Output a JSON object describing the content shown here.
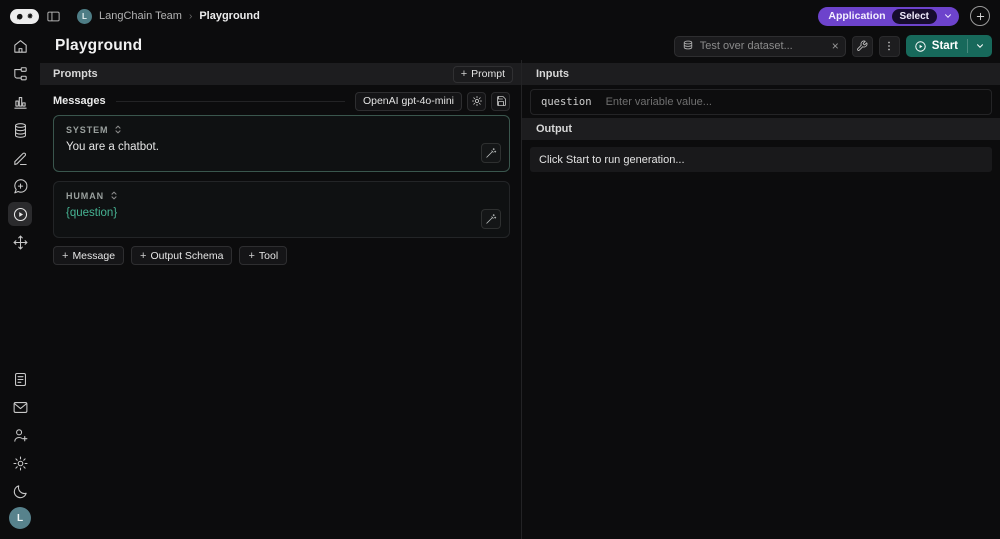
{
  "topbar": {
    "team_name": "LangChain Team",
    "breadcrumb_separator": "›",
    "page_name": "Playground",
    "avatar_letter": "L",
    "application_button": "Application",
    "select_button": "Select"
  },
  "page_header": {
    "title": "Playground",
    "dataset_input_placeholder": "Test over dataset...",
    "start_button": "Start"
  },
  "prompts_panel": {
    "header": "Prompts",
    "add_prompt": "Prompt",
    "messages_header": "Messages",
    "model_selector": "OpenAI gpt-4o-mini",
    "messages": [
      {
        "role": "SYSTEM",
        "content": "You are a chatbot."
      },
      {
        "role": "HUMAN",
        "content": "{question}"
      }
    ],
    "add_message": "Message",
    "add_output_schema": "Output Schema",
    "add_tool": "Tool"
  },
  "io_panel": {
    "inputs_header": "Inputs",
    "variable_name": "question",
    "variable_placeholder": "Enter variable value...",
    "output_header": "Output",
    "output_empty_text": "Click Start to run generation..."
  },
  "sidebar": {
    "avatar_letter": "L",
    "nav_icons": [
      "home",
      "tracing",
      "dashboards",
      "datasets",
      "annotation",
      "feedback",
      "playground",
      "deployments"
    ],
    "bottom_icons": [
      "docs",
      "mail",
      "invite-user",
      "settings",
      "dark-mode",
      "user-avatar"
    ],
    "active_item": "playground"
  },
  "glyphs": {
    "plus": "+",
    "close": "×"
  },
  "colors": {
    "accent_purple": "#6d43cc",
    "accent_green": "#17695b",
    "variable_teal": "#46b393",
    "system_card_border": "#3a564d",
    "panel_header_bg": "#1d1d1f",
    "page_bg": "#0c0c0d"
  }
}
